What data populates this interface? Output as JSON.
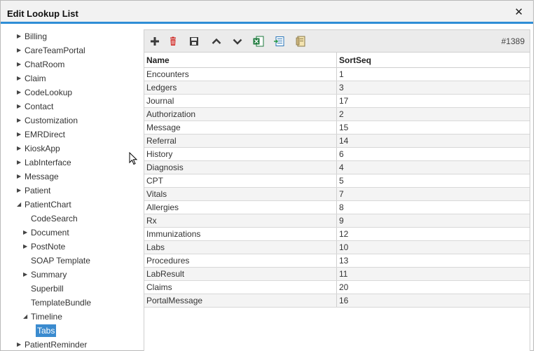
{
  "window": {
    "title": "Edit Lookup List",
    "close_glyph": "✕"
  },
  "colors": {
    "accent": "#2f8ed6",
    "selected": "#3b8bcf"
  },
  "tree": [
    {
      "label": "Billing",
      "level": 0,
      "arrow": "▶"
    },
    {
      "label": "CareTeamPortal",
      "level": 0,
      "arrow": "▶"
    },
    {
      "label": "ChatRoom",
      "level": 0,
      "arrow": "▶"
    },
    {
      "label": "Claim",
      "level": 0,
      "arrow": "▶"
    },
    {
      "label": "CodeLookup",
      "level": 0,
      "arrow": "▶"
    },
    {
      "label": "Contact",
      "level": 0,
      "arrow": "▶"
    },
    {
      "label": "Customization",
      "level": 0,
      "arrow": "▶"
    },
    {
      "label": "EMRDirect",
      "level": 0,
      "arrow": "▶"
    },
    {
      "label": "KioskApp",
      "level": 0,
      "arrow": "▶"
    },
    {
      "label": "LabInterface",
      "level": 0,
      "arrow": "▶"
    },
    {
      "label": "Message",
      "level": 0,
      "arrow": "▶"
    },
    {
      "label": "Patient",
      "level": 0,
      "arrow": "▶"
    },
    {
      "label": "PatientChart",
      "level": 0,
      "arrow": "◢"
    },
    {
      "label": "CodeSearch",
      "level": 1,
      "arrow": ""
    },
    {
      "label": "Document",
      "level": 1,
      "arrow": "▶"
    },
    {
      "label": "PostNote",
      "level": 1,
      "arrow": "▶"
    },
    {
      "label": "SOAP Template",
      "level": 1,
      "arrow": ""
    },
    {
      "label": "Summary",
      "level": 1,
      "arrow": "▶"
    },
    {
      "label": "Superbill",
      "level": 1,
      "arrow": ""
    },
    {
      "label": "TemplateBundle",
      "level": 1,
      "arrow": ""
    },
    {
      "label": "Timeline",
      "level": 1,
      "arrow": "◢"
    },
    {
      "label": "Tabs",
      "level": 2,
      "arrow": "",
      "selected": true
    },
    {
      "label": "PatientReminder",
      "level": 0,
      "arrow": "▶"
    }
  ],
  "toolbar": {
    "icons": [
      "add-icon",
      "delete-icon",
      "save-icon",
      "move-up-icon",
      "move-down-icon",
      "export-excel-icon",
      "import-icon",
      "report-icon"
    ],
    "record_id": "#1389"
  },
  "table": {
    "columns": [
      "Name",
      "SortSeq"
    ],
    "rows": [
      [
        "Encounters",
        "1"
      ],
      [
        "Ledgers",
        "3"
      ],
      [
        "Journal",
        "17"
      ],
      [
        "Authorization",
        "2"
      ],
      [
        "Message",
        "15"
      ],
      [
        "Referral",
        "14"
      ],
      [
        "History",
        "6"
      ],
      [
        "Diagnosis",
        "4"
      ],
      [
        "CPT",
        "5"
      ],
      [
        "Vitals",
        "7"
      ],
      [
        "Allergies",
        "8"
      ],
      [
        "Rx",
        "9"
      ],
      [
        "Immunizations",
        "12"
      ],
      [
        "Labs",
        "10"
      ],
      [
        "Procedures",
        "13"
      ],
      [
        "LabResult",
        "11"
      ],
      [
        "Claims",
        "20"
      ],
      [
        "PortalMessage",
        "16"
      ]
    ]
  }
}
